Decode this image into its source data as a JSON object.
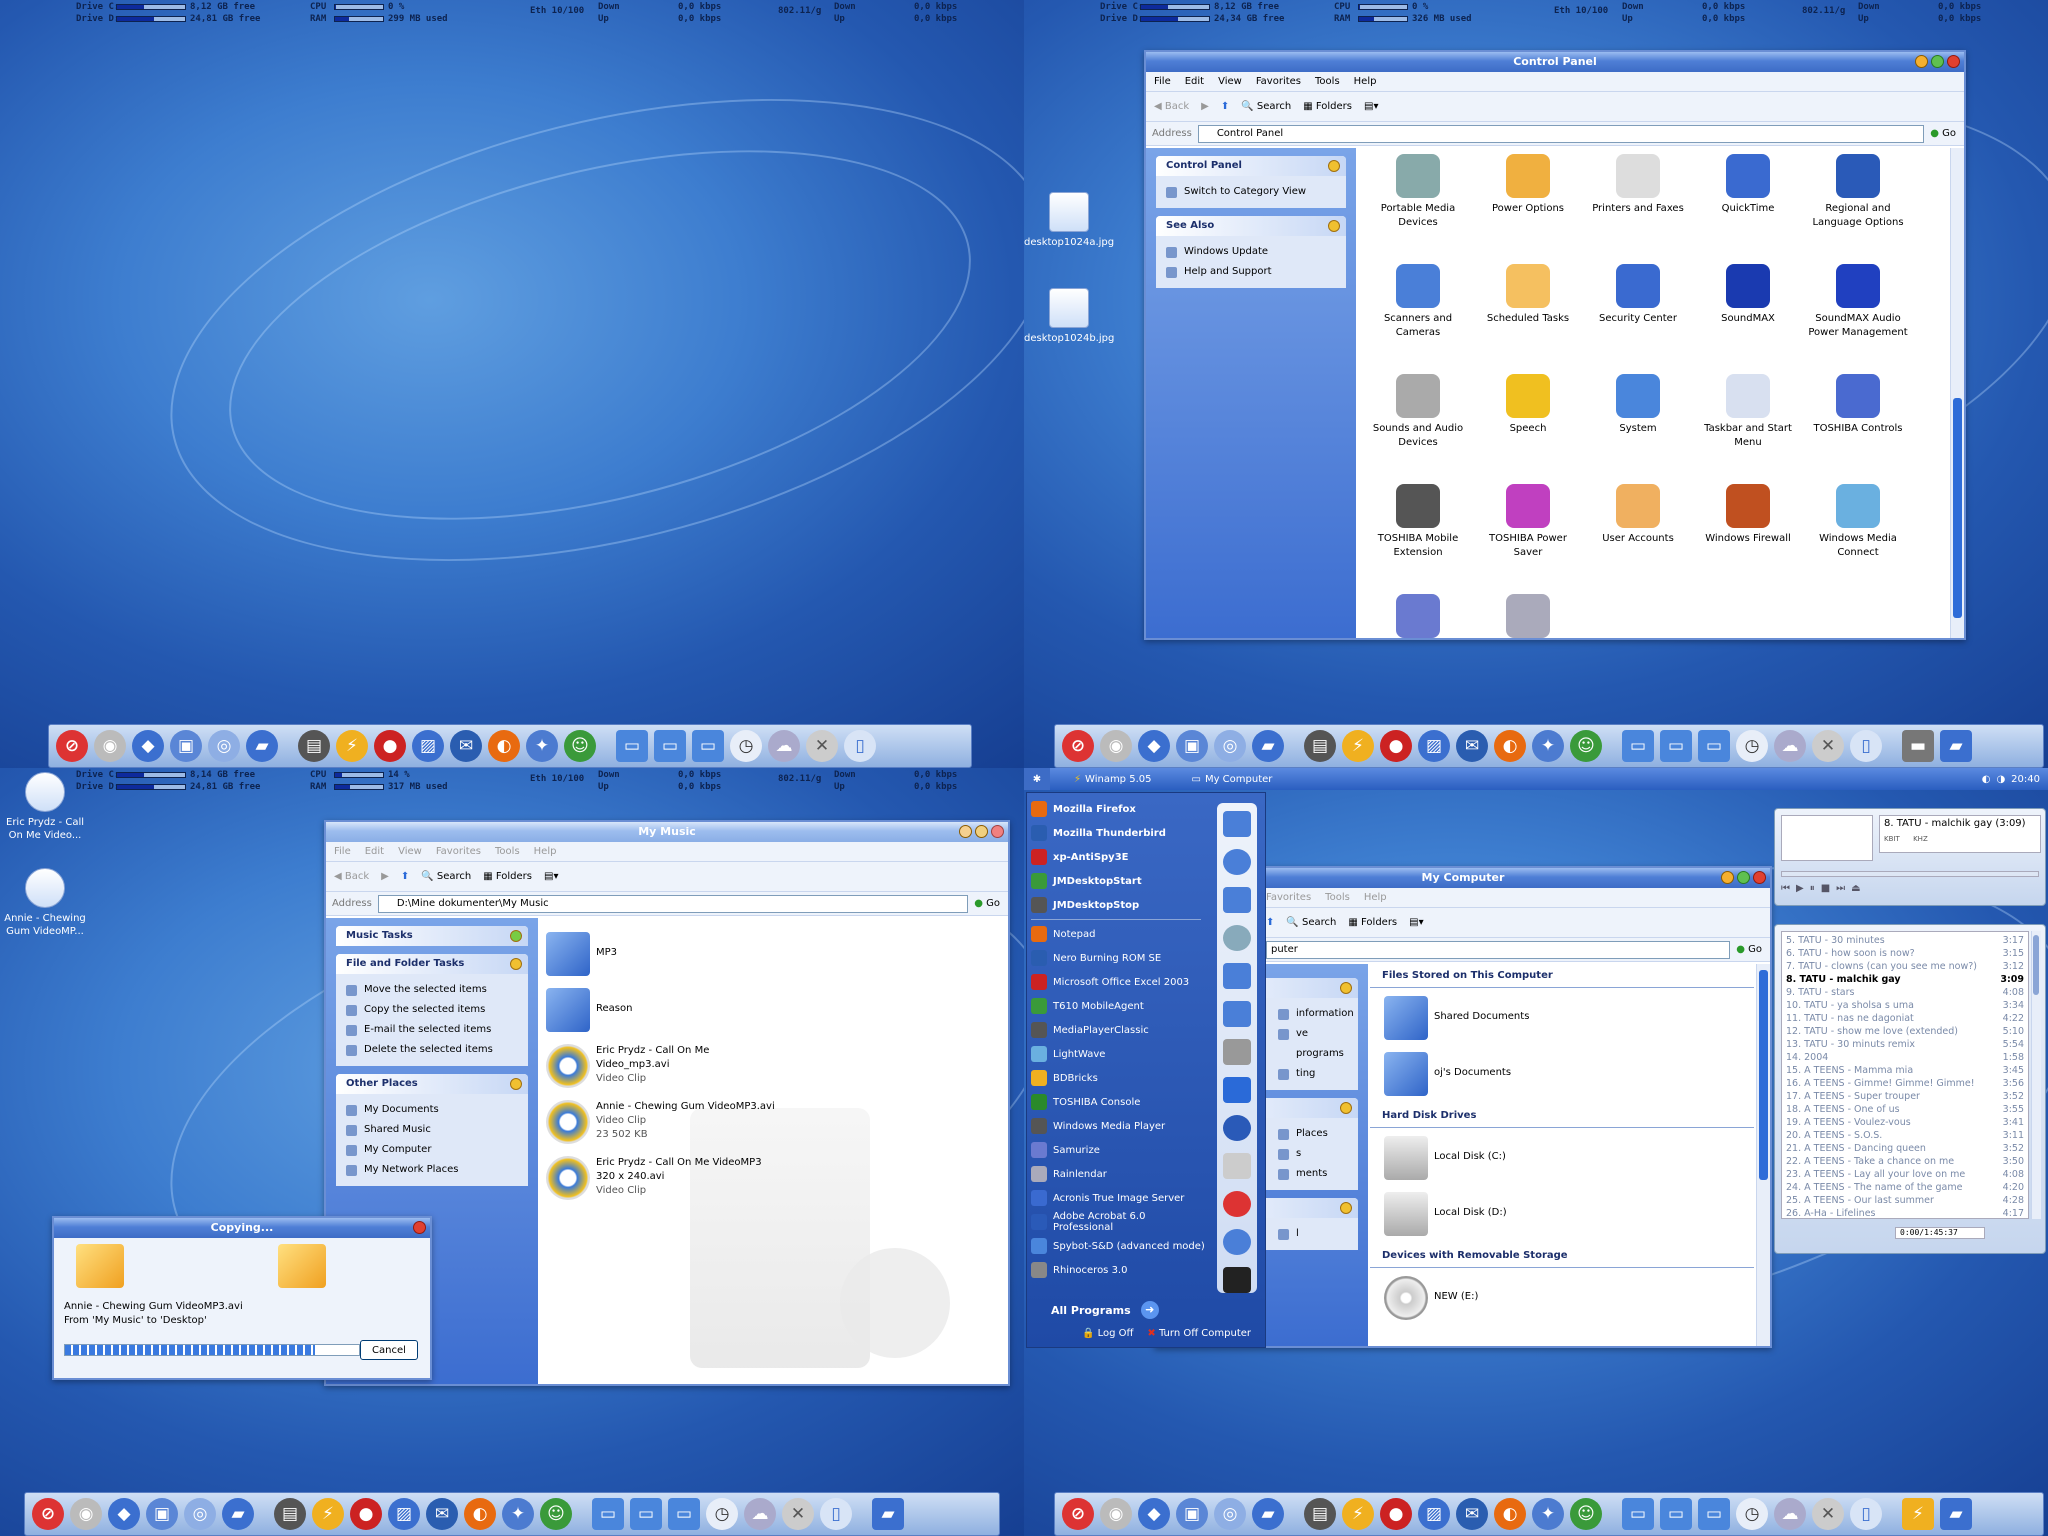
{
  "stats_tl": {
    "drive_c": "Drive C:",
    "drive_c_val": "8,12 GB free",
    "drive_d": "Drive D:",
    "drive_d_val": "24,81 GB free",
    "cpu": "CPU",
    "cpu_val": "0 %",
    "ram": "RAM",
    "ram_val": "299 MB used",
    "eth": "Eth 10/100",
    "down": "Down",
    "down_val": "0,0 kbps",
    "up": "Up",
    "up_val": "0,0 kbps",
    "wifi": "802.11/g",
    "down2": "Down",
    "down2_val": "0,0 kbps",
    "up2": "Up",
    "up2_val": "0,0 kbps"
  },
  "stats_tr": {
    "drive_c": "Drive C:",
    "drive_c_val": "8,12 GB free",
    "drive_d": "Drive D:",
    "drive_d_val": "24,34 GB free",
    "cpu": "CPU",
    "cpu_val": "0 %",
    "ram": "RAM",
    "ram_val": "326 MB used",
    "eth": "Eth 10/100",
    "down": "Down",
    "down_val": "0,0 kbps",
    "up": "Up",
    "up_val": "0,0 kbps",
    "wifi": "802.11/g",
    "down2": "Down",
    "down2_val": "0,0 kbps",
    "up2": "Up",
    "up2_val": "0,0 kbps"
  },
  "stats_bl": {
    "drive_c": "Drive C:",
    "drive_c_val": "8,14 GB free",
    "drive_d": "Drive D:",
    "drive_d_val": "24,81 GB free",
    "cpu": "CPU",
    "cpu_val": "14 %",
    "ram": "RAM",
    "ram_val": "317 MB used",
    "eth": "Eth 10/100",
    "down": "Down",
    "down_val": "0,0 kbps",
    "up": "Up",
    "up_val": "0,0 kbps",
    "wifi": "802.11/g",
    "down2": "Down",
    "down2_val": "0,0 kbps",
    "up2": "Up",
    "up2_val": "0,0 kbps"
  },
  "colors": {
    "xp_blue": "#3d6cc6",
    "desktop": "#2458b0",
    "taskpane": "#3c6dd0"
  },
  "control_panel": {
    "title": "Control Panel",
    "menu": [
      "File",
      "Edit",
      "View",
      "Favorites",
      "Tools",
      "Help"
    ],
    "toolbar": {
      "back": "Back",
      "search": "Search",
      "folders": "Folders"
    },
    "address_label": "Address",
    "address": "Control Panel",
    "go": "Go",
    "task1_title": "Control Panel",
    "task1_items": [
      "Switch to Category View"
    ],
    "task2_title": "See Also",
    "task2_items": [
      "Windows Update",
      "Help and Support"
    ],
    "items": [
      "Portable Media Devices",
      "Power Options",
      "Printers and Faxes",
      "QuickTime",
      "Regional and Language Options",
      "Scanners and Cameras",
      "Scheduled Tasks",
      "Security Center",
      "SoundMAX",
      "SoundMAX Audio Power Management",
      "Sounds and Audio Devices",
      "Speech",
      "System",
      "Taskbar and Start Menu",
      "TOSHIBA Controls",
      "TOSHIBA Mobile Extension",
      "TOSHIBA Power Saver",
      "User Accounts",
      "Windows Firewall",
      "Windows Media Connect",
      "",
      ""
    ]
  },
  "desk_tr": [
    "desktop1024a.jpg",
    "desktop1024b.jpg"
  ],
  "desk_bl": [
    "Eric Prydz - Call On Me Video...",
    "Annie - Chewing Gum VideoMP..."
  ],
  "my_music": {
    "title": "My Music",
    "menu": [
      "File",
      "Edit",
      "View",
      "Favorites",
      "Tools",
      "Help"
    ],
    "toolbar": {
      "back": "Back",
      "search": "Search",
      "folders": "Folders"
    },
    "address_label": "Address",
    "address": "D:\\Mine dokumenter\\My Music",
    "go": "Go",
    "task1_title": "Music Tasks",
    "task2_title": "File and Folder Tasks",
    "task2_items": [
      "Move the selected items",
      "Copy the selected items",
      "E-mail the selected items",
      "Delete the selected items"
    ],
    "task3_title": "Other Places",
    "task3_items": [
      "My Documents",
      "Shared Music",
      "My Computer",
      "My Network Places"
    ],
    "folders": [
      "MP3",
      "Reason"
    ],
    "files": [
      {
        "l1": "Eric Prydz - Call On Me",
        "l2": "Video_mp3.avi",
        "l3": "Video Clip"
      },
      {
        "l1": "Annie - Chewing Gum VideoMP3.avi",
        "l2": "Video Clip",
        "l3": "23 502 KB"
      },
      {
        "l1": "Eric Prydz - Call On Me VideoMP3",
        "l2": "320 x 240.avi",
        "l3": "Video Clip"
      }
    ]
  },
  "copying": {
    "title": "Copying...",
    "file": "Annie - Chewing Gum VideoMP3.avi",
    "from": "From 'My Music' to 'Desktop'",
    "cancel": "Cancel",
    "progress": 0.85
  },
  "taskbar_br": {
    "winamp": "Winamp 5.05",
    "mycomputer": "My Computer",
    "clock": "20:40"
  },
  "start_menu": {
    "pinned": [
      "Mozilla Firefox",
      "Mozilla Thunderbird",
      "xp-AntiSpy3E",
      "JMDesktopStart",
      "JMDesktopStop"
    ],
    "recent": [
      "Notepad",
      "Nero Burning ROM SE",
      "Microsoft Office Excel 2003",
      "T610 MobileAgent",
      "MediaPlayerClassic",
      "LightWave",
      "BDBricks",
      "TOSHIBA Console",
      "Windows Media Player",
      "Samurize",
      "Rainlendar",
      "Acronis True Image Server",
      "Adobe Acrobat 6.0 Professional",
      "Spybot-S&D (advanced mode)",
      "Rhinoceros 3.0"
    ],
    "all_programs": "All Programs",
    "logoff": "Log Off",
    "turnoff": "Turn Off Computer"
  },
  "my_computer": {
    "title": "My Computer",
    "menu": [
      "Favorites",
      "Tools",
      "Help"
    ],
    "toolbar": {
      "search": "Search",
      "folders": "Folders"
    },
    "address": "puter",
    "go": "Go",
    "side_a": [
      "information",
      "ve programs",
      "ting"
    ],
    "side_b": [
      "Places",
      "s",
      "ments"
    ],
    "side_c": [
      "l"
    ],
    "sec1": "Files Stored on This Computer",
    "sec1_items": [
      "Shared Documents",
      "oj's Documents"
    ],
    "sec2": "Hard Disk Drives",
    "sec2_items": [
      "Local Disk (C:)",
      "Local Disk (D:)"
    ],
    "sec3": "Devices with Removable Storage",
    "sec3_items": [
      "NEW (E:)"
    ]
  },
  "winamp": {
    "now_playing": "8. TATU - malchik gay (3:09)",
    "kbit": "KBIT",
    "khz": "KHZ",
    "playlist": [
      {
        "t": "5. TATU - 30 minutes",
        "d": "3:17"
      },
      {
        "t": "6. TATU - how soon is now?",
        "d": "3:15"
      },
      {
        "t": "7. TATU - clowns (can you see me now?)",
        "d": "3:12"
      },
      {
        "t": "8. TATU - malchik gay",
        "d": "3:09"
      },
      {
        "t": "9. TATU - stars",
        "d": "4:08"
      },
      {
        "t": "10. TATU - ya sholsa s uma",
        "d": "3:34"
      },
      {
        "t": "11. TATU - nas ne dagoniat",
        "d": "4:22"
      },
      {
        "t": "12. TATU - show me love (extended)",
        "d": "5:10"
      },
      {
        "t": "13. TATU - 30 minuts remix",
        "d": "5:54"
      },
      {
        "t": "14. 2004",
        "d": "1:58"
      },
      {
        "t": "15. A TEENS - Mamma mia",
        "d": "3:45"
      },
      {
        "t": "16. A TEENS - Gimme! Gimme! Gimme!",
        "d": "3:56"
      },
      {
        "t": "17. A TEENS - Super trouper",
        "d": "3:52"
      },
      {
        "t": "18. A TEENS - One of us",
        "d": "3:55"
      },
      {
        "t": "19. A TEENS - Voulez-vous",
        "d": "3:41"
      },
      {
        "t": "20. A TEENS - S.O.S.",
        "d": "3:11"
      },
      {
        "t": "21. A TEENS - Dancing queen",
        "d": "3:52"
      },
      {
        "t": "22. A TEENS - Take a chance on me",
        "d": "3:50"
      },
      {
        "t": "23. A TEENS - Lay all your love on me",
        "d": "4:08"
      },
      {
        "t": "24. A TEENS - The name of the game",
        "d": "4:20"
      },
      {
        "t": "25. A TEENS - Our last summer",
        "d": "4:28"
      },
      {
        "t": "26. A-Ha - Lifelines",
        "d": "4:17"
      }
    ],
    "status": "0:00/1:45:37"
  }
}
